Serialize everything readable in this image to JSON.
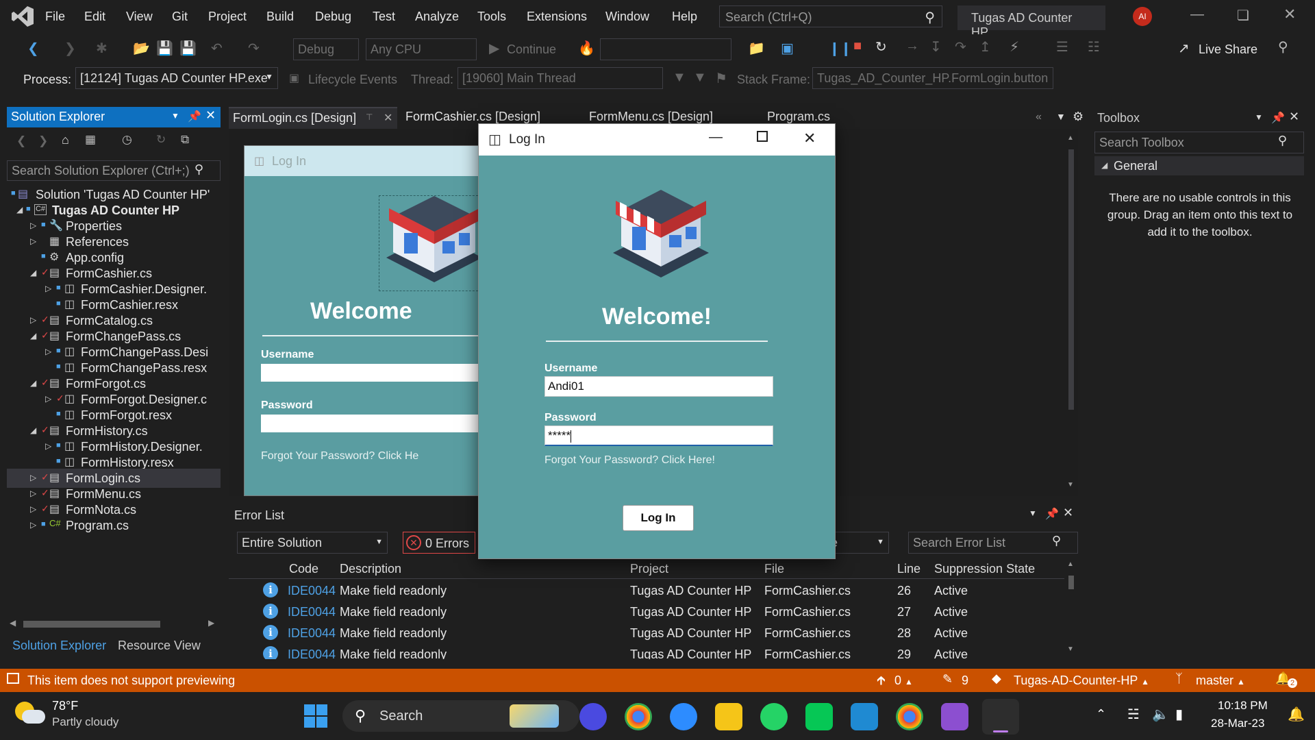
{
  "menu": {
    "items": [
      "File",
      "Edit",
      "View",
      "Git",
      "Project",
      "Build",
      "Debug",
      "Test",
      "Analyze",
      "Tools",
      "Extensions",
      "Window",
      "Help"
    ],
    "search_placeholder": "Search (Ctrl+Q)",
    "app_title": "Tugas AD Counter HP",
    "avatar_initials": "AI"
  },
  "toolbar": {
    "config": "Debug",
    "platform": "Any CPU",
    "continue_label": "Continue",
    "live_share": "Live Share"
  },
  "debug_bar": {
    "process_label": "Process:",
    "process_value": "[12124] Tugas AD Counter HP.exe",
    "lifecycle_label": "Lifecycle Events",
    "thread_label": "Thread:",
    "thread_value": "[19060] Main Thread",
    "stack_label": "Stack Frame:",
    "stack_value": "Tugas_AD_Counter_HP.FormLogin.button"
  },
  "solution_explorer": {
    "title": "Solution Explorer",
    "search_placeholder": "Search Solution Explorer (Ctrl+;)",
    "tree": [
      {
        "label": "Solution 'Tugas AD Counter HP'",
        "icon": "solution-icon",
        "indent": 0,
        "bold": false
      },
      {
        "label": "Tugas AD Counter HP",
        "icon": "csharp-project-icon",
        "indent": 1,
        "bold": true
      },
      {
        "label": "Properties",
        "icon": "wrench-icon",
        "indent": 2,
        "bold": false
      },
      {
        "label": "References",
        "icon": "references-icon",
        "indent": 2,
        "bold": false
      },
      {
        "label": "App.config",
        "icon": "config-icon",
        "indent": 2,
        "bold": false
      },
      {
        "label": "FormCashier.cs",
        "icon": "form-icon",
        "indent": 2,
        "bold": false
      },
      {
        "label": "FormCashier.Designer.",
        "icon": "designer-icon",
        "indent": 3,
        "bold": false
      },
      {
        "label": "FormCashier.resx",
        "icon": "resx-icon",
        "indent": 3,
        "bold": false
      },
      {
        "label": "FormCatalog.cs",
        "icon": "form-icon",
        "indent": 2,
        "bold": false
      },
      {
        "label": "FormChangePass.cs",
        "icon": "form-icon",
        "indent": 2,
        "bold": false
      },
      {
        "label": "FormChangePass.Desi",
        "icon": "designer-icon",
        "indent": 3,
        "bold": false
      },
      {
        "label": "FormChangePass.resx",
        "icon": "resx-icon",
        "indent": 3,
        "bold": false
      },
      {
        "label": "FormForgot.cs",
        "icon": "form-icon",
        "indent": 2,
        "bold": false
      },
      {
        "label": "FormForgot.Designer.c",
        "icon": "designer-icon",
        "indent": 3,
        "bold": false
      },
      {
        "label": "FormForgot.resx",
        "icon": "resx-icon",
        "indent": 3,
        "bold": false
      },
      {
        "label": "FormHistory.cs",
        "icon": "form-icon",
        "indent": 2,
        "bold": false
      },
      {
        "label": "FormHistory.Designer.",
        "icon": "designer-icon",
        "indent": 3,
        "bold": false
      },
      {
        "label": "FormHistory.resx",
        "icon": "resx-icon",
        "indent": 3,
        "bold": false
      },
      {
        "label": "FormLogin.cs",
        "icon": "form-icon",
        "indent": 2,
        "bold": false
      },
      {
        "label": "FormMenu.cs",
        "icon": "form-icon",
        "indent": 2,
        "bold": false
      },
      {
        "label": "FormNota.cs",
        "icon": "form-icon",
        "indent": 2,
        "bold": false
      },
      {
        "label": "Program.cs",
        "icon": "csharp-file-icon",
        "indent": 2,
        "bold": false
      }
    ],
    "tabs": [
      "Solution Explorer",
      "Resource View"
    ]
  },
  "document_tabs": [
    "FormLogin.cs [Design]",
    "FormCashier.cs [Design]",
    "FormMenu.cs [Design]",
    "Program.cs"
  ],
  "designer_preview": {
    "title": "Log In",
    "welcome": "Welcome",
    "username_label": "Username",
    "password_label": "Password",
    "forgot_text": "Forgot Your Password? Click He"
  },
  "error_list": {
    "title": "Error List",
    "scope": "Entire Solution",
    "errors_label": "0 Errors",
    "search_placeholder": "Search Error List",
    "filter_suffix": "e",
    "columns": [
      "Code",
      "Description",
      "Project",
      "File",
      "Line",
      "Suppression State"
    ],
    "rows": [
      {
        "code": "IDE0044",
        "description": "Make field readonly",
        "project": "Tugas AD Counter HP",
        "file": "FormCashier.cs",
        "line": "26",
        "state": "Active"
      },
      {
        "code": "IDE0044",
        "description": "Make field readonly",
        "project": "Tugas AD Counter HP",
        "file": "FormCashier.cs",
        "line": "27",
        "state": "Active"
      },
      {
        "code": "IDE0044",
        "description": "Make field readonly",
        "project": "Tugas AD Counter HP",
        "file": "FormCashier.cs",
        "line": "28",
        "state": "Active"
      },
      {
        "code": "IDE0044",
        "description": "Make field readonly",
        "project": "Tugas AD Counter HP",
        "file": "FormCashier.cs",
        "line": "29",
        "state": "Active"
      }
    ]
  },
  "toolbox": {
    "title": "Toolbox",
    "search_placeholder": "Search Toolbox",
    "group": "General",
    "empty_message": "There are no usable controls in this group. Drag an item onto this text to add it to the toolbox."
  },
  "login_dialog": {
    "title": "Log In",
    "welcome": "Welcome!",
    "username_label": "Username",
    "username_value": "Andi01",
    "password_label": "Password",
    "password_value": "*****",
    "forgot_text": "Forgot Your Password? Click Here!",
    "login_button": "Log In"
  },
  "statusbar": {
    "message": "This item does not support previewing",
    "up_count": "0",
    "pencil_count": "9",
    "repo": "Tugas-AD-Counter-HP",
    "branch": "master",
    "notifications": "2"
  },
  "taskbar": {
    "temperature": "78°F",
    "weather": "Partly cloudy",
    "search_label": "Search",
    "time": "10:18 PM",
    "date": "28-Mar-23"
  },
  "colors": {
    "accent": "#0e70c0",
    "statusbar": "#ca5100",
    "form_bg": "#5a9ea1",
    "info": "#4ea1e5",
    "error": "#e04848"
  }
}
